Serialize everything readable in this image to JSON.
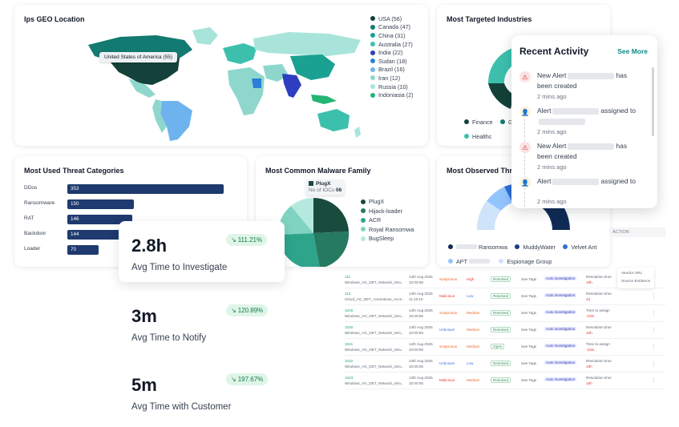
{
  "geo": {
    "title": "Ips GEO Location",
    "tooltip": "United States of America (55)",
    "legend": [
      {
        "label": "USA (56)",
        "color": "#14413a"
      },
      {
        "label": "Canada (47)",
        "color": "#127a70"
      },
      {
        "label": "China (31)",
        "color": "#1aa191"
      },
      {
        "label": "Australia (27)",
        "color": "#3cc0ad"
      },
      {
        "label": "India (22)",
        "color": "#2d3fc0"
      },
      {
        "label": "Sudan (18)",
        "color": "#2c7fd6"
      },
      {
        "label": "Brazil (16)",
        "color": "#6fb3ee"
      },
      {
        "label": "Iran (12)",
        "color": "#8fd7cc"
      },
      {
        "label": "Russia (10)",
        "color": "#a9e4da"
      },
      {
        "label": "Indoniasia (2)",
        "color": "#23b574"
      }
    ]
  },
  "industries": {
    "title": "Most Targeted Industries",
    "legend": [
      {
        "label": "Finance",
        "color": "#14413a"
      },
      {
        "label": "Go",
        "color": "#127a70"
      },
      {
        "label": "Healthc",
        "color": "#3cc0ad"
      }
    ]
  },
  "recent": {
    "title": "Recent Activity",
    "see_more": "See More",
    "items": [
      {
        "type": "alert",
        "pre": "New Alert",
        "post": "has been created",
        "time": "2 mins ago"
      },
      {
        "type": "user",
        "pre": "Alert",
        "post": "assigned to",
        "time": "2 mins ago"
      },
      {
        "type": "alert",
        "pre": "New Alert",
        "post": "has been created",
        "time": "2 mins ago"
      },
      {
        "type": "user",
        "pre": "Alert",
        "post": "assigned to",
        "time": "2 mins ago"
      }
    ]
  },
  "threat": {
    "title": "Most Used Threat Categories",
    "rows": [
      {
        "label": "DDos",
        "value": 353
      },
      {
        "label": "Ransomware",
        "value": 150
      },
      {
        "label": "RAT",
        "value": 146
      },
      {
        "label": "Backdoor",
        "value": 144
      },
      {
        "label": "Loader",
        "value": 70
      }
    ]
  },
  "malware": {
    "title": "Most Common  Malware Family",
    "tooltip_name": "PlugX",
    "tooltip_label": "No of IOCs",
    "tooltip_value": "06",
    "legend": [
      {
        "label": "PlugX",
        "color": "#1a4c3e"
      },
      {
        "label": "Hijack-loader",
        "color": "#257a60"
      },
      {
        "label": "ACR",
        "color": "#2ea58a"
      },
      {
        "label": "Royal Ransomwa",
        "color": "#7fd3c0"
      },
      {
        "label": "BugSleep",
        "color": "#b6e9dd"
      }
    ]
  },
  "observed": {
    "title": "Most Observed Threa",
    "legend": [
      {
        "label": "Ransomwa",
        "color": "#0f2b55",
        "redacted": true
      },
      {
        "label": "MuddyWater",
        "color": "#1e3a8a"
      },
      {
        "label": "Velvet Ant",
        "color": "#2f6fdb"
      },
      {
        "label": "APT",
        "color": "#93c5fd",
        "redacted": true
      },
      {
        "label": "Espionage Group",
        "color": "#cfe3fb"
      }
    ]
  },
  "metrics": [
    {
      "value": "2.8h",
      "label": "Avg Time to Investigate",
      "change": "111.21%"
    },
    {
      "value": "3m",
      "label": "Avg Time to Notify",
      "change": "120.89%"
    },
    {
      "value": "5m",
      "label": "Avg Time with Customer",
      "change": "197.67%"
    }
  ],
  "alerts_table": {
    "action_header": "ACTION",
    "context_menu": [
      "Vendor URL",
      "Source Evidence"
    ],
    "rows": [
      {
        "id": "111",
        "name": "Windows_AG_DET_Network_intru..",
        "date": "14th Aug 2025",
        "time": "10:00:05",
        "severity": "Suspicious",
        "sev": "orange",
        "priority": "High",
        "pri": "red",
        "status": "Resolved",
        "tags": "See Tags",
        "auto": "Auto investigation",
        "resp": "Resolution time",
        "resp2": "18h"
      },
      {
        "id": "112",
        "name": "Cloud_AG_DET_Anomalous_Acce..",
        "date": "14th Aug 2025",
        "time": "11:10:10",
        "severity": "Malicious",
        "sev": "red",
        "priority": "Low",
        "pri": "blue",
        "status": "Resolved",
        "tags": "See Tags",
        "auto": "Auto investigation",
        "resp": "Resolution time",
        "resp2": "4d"
      },
      {
        "id": "1019",
        "name": "Windows_AG_DET_Network_intru..",
        "date": "14th Aug 2025",
        "time": "10:00:05",
        "severity": "Suspicious",
        "sev": "orange",
        "priority": "Medium",
        "pri": "orange",
        "status": "Resolved",
        "tags": "See Tags",
        "auto": "Auto investigation",
        "resp": "Time to assign",
        "resp2": "-23m"
      },
      {
        "id": "1020",
        "name": "Windows_AG_DET_Network_intru..",
        "date": "14th Aug 2025",
        "time": "10:00:05",
        "severity": "Unknown",
        "sev": "blue",
        "priority": "Medium",
        "pri": "orange",
        "status": "Resolved",
        "tags": "See Tags",
        "auto": "Auto investigation",
        "resp": "Resolution time",
        "resp2": "18h"
      },
      {
        "id": "1021",
        "name": "Windows_AG_DET_Network_intru..",
        "date": "14th Aug 2025",
        "time": "10:00:05",
        "severity": "Suspicious",
        "sev": "orange",
        "priority": "Medium",
        "pri": "orange",
        "status": "Open",
        "tags": "See Tags",
        "auto": "Auto investigation",
        "resp": "Time to assign",
        "resp2": "-23m"
      },
      {
        "id": "1022",
        "name": "Windows_AG_DET_Network_intru..",
        "date": "14th Aug 2025",
        "time": "10:00:05",
        "severity": "Unknown",
        "sev": "blue",
        "priority": "Low",
        "pri": "blue",
        "status": "Resolved",
        "tags": "See Tags",
        "auto": "Auto investigation",
        "resp": "Resolution time",
        "resp2": "18h"
      },
      {
        "id": "1023",
        "name": "Windows_AG_DET_Network_intru..",
        "date": "14th Aug 2025",
        "time": "10:00:05",
        "severity": "Malicious",
        "sev": "red",
        "priority": "Medium",
        "pri": "orange",
        "status": "Resolved",
        "tags": "See Tags",
        "auto": "Auto investigation",
        "resp": "Resolution time",
        "resp2": "18h"
      }
    ]
  }
}
